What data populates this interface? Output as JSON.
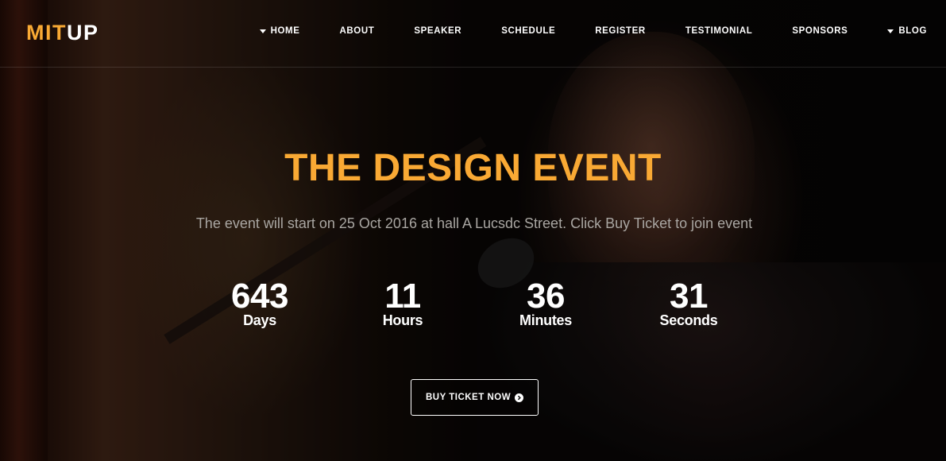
{
  "brand": {
    "logo_part1": "MIT",
    "logo_part2": "UP",
    "accent_color": "#f9a934"
  },
  "nav": {
    "items": [
      {
        "label": "HOME",
        "has_dropdown": true
      },
      {
        "label": "ABOUT",
        "has_dropdown": false
      },
      {
        "label": "SPEAKER",
        "has_dropdown": false
      },
      {
        "label": "SCHEDULE",
        "has_dropdown": false
      },
      {
        "label": "REGISTER",
        "has_dropdown": false
      },
      {
        "label": "TESTIMONIAL",
        "has_dropdown": false
      },
      {
        "label": "SPONSORS",
        "has_dropdown": false
      },
      {
        "label": "BLOG",
        "has_dropdown": true
      }
    ]
  },
  "hero": {
    "title": "THE DESIGN EVENT",
    "subtitle": "The event will start on 25 Oct 2016 at hall A Lucsdc Street. Click Buy Ticket to join event",
    "countdown": [
      {
        "value": "643",
        "label": "Days"
      },
      {
        "value": "11",
        "label": "Hours"
      },
      {
        "value": "36",
        "label": "Minutes"
      },
      {
        "value": "31",
        "label": "Seconds"
      }
    ],
    "cta_label": "BUY TICKET NOW",
    "cta_icon": "chevron-right-circle-icon"
  }
}
